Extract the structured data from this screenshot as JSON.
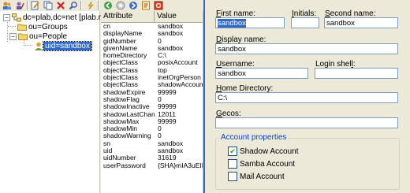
{
  "tree": {
    "root": "dc=plab,dc=net [plab.net]",
    "groups": "ou=Groups",
    "people": "ou=People",
    "user": "uid=sandbox"
  },
  "attributes": {
    "headers": [
      "Attribute",
      "Value"
    ],
    "rows": [
      [
        "cn",
        "sandbox"
      ],
      [
        "displayName",
        "sandbox"
      ],
      [
        "gidNumber",
        "0"
      ],
      [
        "givenName",
        "sandbox"
      ],
      [
        "homeDirectory",
        "C:\\"
      ],
      [
        "objectClass",
        "posixAccount"
      ],
      [
        "objectClass",
        "top"
      ],
      [
        "objectClass",
        "inetOrgPerson"
      ],
      [
        "objectClass",
        "shadowAccount"
      ],
      [
        "shadowExpire",
        "99999"
      ],
      [
        "shadowFlag",
        "0"
      ],
      [
        "shadowInactive",
        "99999"
      ],
      [
        "shadowLastChange",
        "12011"
      ],
      [
        "shadowMax",
        "99999"
      ],
      [
        "shadowMin",
        "0"
      ],
      [
        "shadowWarning",
        "0"
      ],
      [
        "sn",
        "sandbox"
      ],
      [
        "uid",
        "sandbox"
      ],
      [
        "uidNumber",
        "31619"
      ],
      [
        "userPassword",
        "{SHA}mIA3uEIDxM"
      ]
    ]
  },
  "form": {
    "first_name_label": "First name:",
    "first_name_value": "sandbox",
    "initials_label": "Initials:",
    "initials_value": "",
    "second_name_label": "Second name:",
    "second_name_value": "sandbox",
    "display_name_label": "Display name:",
    "display_name_value": "sandbox",
    "username_label": "Username:",
    "username_value": "sandbox",
    "login_shell_label": "Login shell:",
    "login_shell_value": "",
    "home_dir_label": "Home Directory:",
    "home_dir_value": "C:\\",
    "gecos_label": "Gecos:",
    "gecos_value": "",
    "account_props_title": "Account properties",
    "shadow_account_label": "Shadow Account",
    "shadow_account_checked": true,
    "samba_account_label": "Samba Account",
    "samba_account_checked": false,
    "mail_account_label": "Mail Account",
    "mail_account_checked": false
  }
}
